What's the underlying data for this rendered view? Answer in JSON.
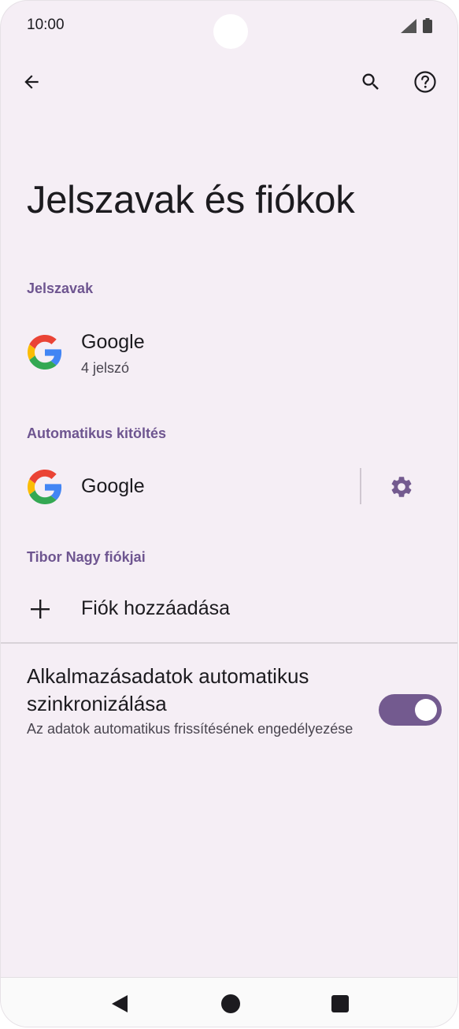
{
  "status_bar": {
    "time": "10:00"
  },
  "icons": {
    "back": "arrow-back-icon",
    "search": "search-icon",
    "help": "help-icon",
    "google": "google-logo-icon",
    "gear": "gear-icon",
    "plus": "plus-icon"
  },
  "page": {
    "title": "Jelszavak és fiókok"
  },
  "passwords": {
    "header": "Jelszavak",
    "item": {
      "title": "Google",
      "subtitle": "4 jelszó"
    }
  },
  "autofill": {
    "header": "Automatikus kitöltés",
    "item": {
      "title": "Google"
    }
  },
  "accounts": {
    "header": "Tibor Nagy fiókjai",
    "add_label": "Fiók hozzáadása"
  },
  "sync": {
    "title": "Alkalmazásadatok automatikus szinkronizálása",
    "subtitle": "Az adatok automatikus frissítésének engedélyezése",
    "enabled": true
  },
  "colors": {
    "background": "#f5eef5",
    "accent": "#735a8f",
    "section_header": "#6e5590"
  }
}
